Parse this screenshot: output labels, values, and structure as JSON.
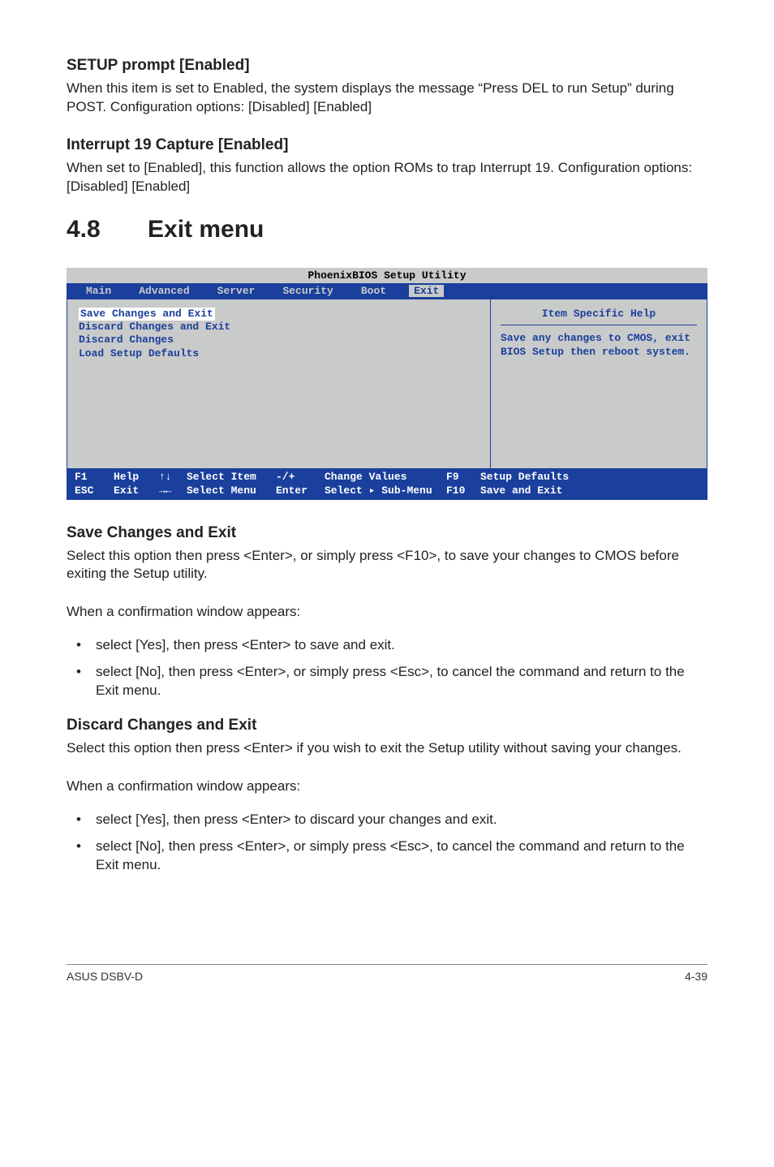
{
  "sections": {
    "setup_prompt": {
      "heading": "SETUP prompt [Enabled]",
      "body": "When this item is set to Enabled, the system displays the message “Press DEL to run Setup” during POST. Configuration options: [Disabled] [Enabled]"
    },
    "interrupt19": {
      "heading": "Interrupt 19 Capture [Enabled]",
      "body": "When set to [Enabled], this function allows the option ROMs to trap Interrupt 19. Configuration options: [Disabled] [Enabled]"
    },
    "exit_menu": {
      "num": "4.8",
      "title": "Exit menu"
    },
    "save_exit": {
      "heading": "Save Changes and Exit",
      "body": "Select this option then press <Enter>, or simply press <F10>, to save your changes to CMOS before exiting the Setup utility.",
      "lead": "When a confirmation window appears:",
      "bullets": [
        "select [Yes], then press <Enter> to save and exit.",
        "select [No], then press <Enter>, or simply press <Esc>, to cancel the command and return to the Exit menu."
      ]
    },
    "discard_exit": {
      "heading": "Discard Changes and Exit",
      "body": "Select this option then press <Enter> if you wish to exit the Setup utility without saving your changes.",
      "lead": "When a confirmation window appears:",
      "bullets": [
        "select [Yes], then press <Enter> to discard your changes and exit.",
        "select [No], then press <Enter>, or simply press <Esc>, to cancel the command and return to the Exit menu."
      ]
    }
  },
  "bios": {
    "title": "PhoenixBIOS Setup Utility",
    "tabs": [
      "Main",
      "Advanced",
      "Server",
      "Security",
      "Boot",
      "Exit"
    ],
    "active_tab": "Exit",
    "items": [
      "Save Changes and Exit",
      "Discard Changes and Exit",
      "Discard Changes",
      "Load Setup Defaults"
    ],
    "help_title": "Item Specific Help",
    "help_text": "Save any changes to CMOS, exit BIOS Setup then reboot system.",
    "footer": {
      "f1": "F1",
      "help": "Help",
      "esc": "ESC",
      "exit": "Exit",
      "updown": "↑↓",
      "leftright": "→←",
      "select_item": "Select Item",
      "select_menu": "Select Menu",
      "pm": "-/+",
      "enter": "Enter",
      "change_values": "Change Values",
      "select_sub": "Select ▸ Sub-Menu",
      "f9": "F9",
      "setup_defaults": "Setup Defaults",
      "f10": "F10",
      "save_exit": "Save and Exit"
    }
  },
  "footer": {
    "left": "ASUS DSBV-D",
    "right": "4-39"
  }
}
